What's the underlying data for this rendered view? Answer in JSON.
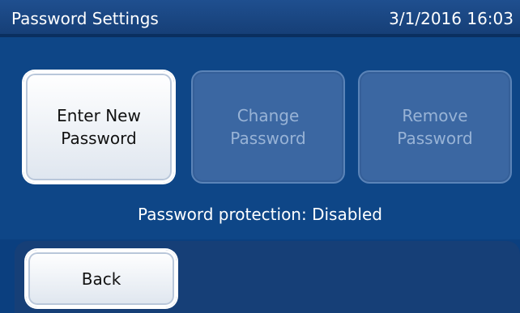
{
  "header": {
    "title": "Password Settings",
    "datetime": "3/1/2016 16:03"
  },
  "actions": {
    "enter_new": "Enter New\nPassword",
    "change": "Change\nPassword",
    "remove": "Remove\nPassword"
  },
  "status": {
    "text": "Password protection: Disabled"
  },
  "footer": {
    "back_label": "Back"
  },
  "colors": {
    "background": "#0b3f7f",
    "header": "#163f77",
    "active_button": "#ffffff",
    "disabled_button": "#3b67a2",
    "disabled_text": "#98b3d6"
  }
}
